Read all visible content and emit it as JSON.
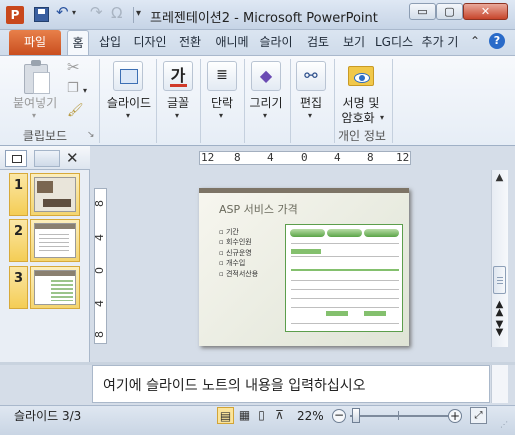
{
  "titlebar": {
    "app_icon": "P",
    "title": "프레젠테이션2  -  Microsoft PowerPoint",
    "min_label": "▭",
    "max_label": "▢",
    "close_label": "✕"
  },
  "qat": {
    "undo": "↶",
    "redo": "↷",
    "symbol": "Ω",
    "customize": "▾"
  },
  "tabs": {
    "file": "파일",
    "home": "홈",
    "insert": "삽입",
    "design": "디자인",
    "transition": "전환",
    "animation": "애니메",
    "slideshow": "슬라이",
    "review": "검토",
    "view": "보기",
    "lg": "LG디스",
    "addin": "추가 기"
  },
  "ribbon": {
    "paste_label": "붙여넣기",
    "clipboard_group": "클립보드",
    "slides_label": "슬라이드",
    "font_label": "글꼴",
    "font_icon": "가",
    "paragraph_label": "단락",
    "drawing_label": "그리기",
    "editing_label": "편집",
    "insert_sig_label1": "서명 및",
    "insert_sig_label2": "암호화",
    "privacy_group": "개인 정보"
  },
  "panel": {
    "close_label": "✕",
    "slides": [
      {
        "num": "1"
      },
      {
        "num": "2"
      },
      {
        "num": "3"
      }
    ]
  },
  "ruler": {
    "h_ticks": [
      "12",
      "8",
      "4",
      "0",
      "4",
      "8",
      "12"
    ],
    "v_ticks": [
      "8",
      "4",
      "0",
      "4",
      "8"
    ]
  },
  "slide": {
    "title": "ASP 서비스 가격",
    "bullets": [
      "기간",
      "회수인원",
      "신규운영",
      "개수입",
      "견적서산용"
    ]
  },
  "notes": {
    "placeholder": "여기에 슬라이드 노트의 내용을 입력하십시오"
  },
  "status": {
    "slide_count": "슬라이드 3/3",
    "zoom": "22%",
    "zoom_level": 22,
    "zoom_minus": "−",
    "zoom_plus": "+"
  },
  "colors": {
    "file_tab": "#d05a2a",
    "thumb_selected": "#f4cd55",
    "close_button": "#c7452b",
    "slide_accent": "#5aa447"
  }
}
